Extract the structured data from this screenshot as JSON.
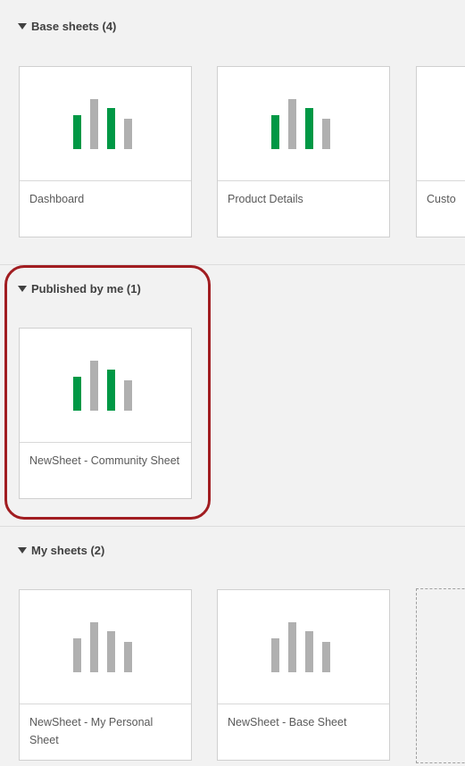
{
  "colors": {
    "bar_green": "#009845",
    "bar_gray": "#b0b0b0",
    "highlight": "#a11d21"
  },
  "sections": {
    "base": {
      "label": "Base sheets (4)",
      "cards": [
        {
          "title": "Dashboard",
          "bar_style": "colored"
        },
        {
          "title": "Product Details",
          "bar_style": "colored"
        },
        {
          "title": "Custo",
          "bar_style": "colored"
        }
      ]
    },
    "published": {
      "label": "Published by me (1)",
      "cards": [
        {
          "title": "NewSheet - Community Sheet",
          "bar_style": "colored"
        }
      ]
    },
    "mine": {
      "label": "My sheets (2)",
      "cards": [
        {
          "title": "NewSheet - My Personal Sheet",
          "bar_style": "gray"
        },
        {
          "title": "NewSheet - Base Sheet",
          "bar_style": "gray"
        }
      ]
    }
  }
}
